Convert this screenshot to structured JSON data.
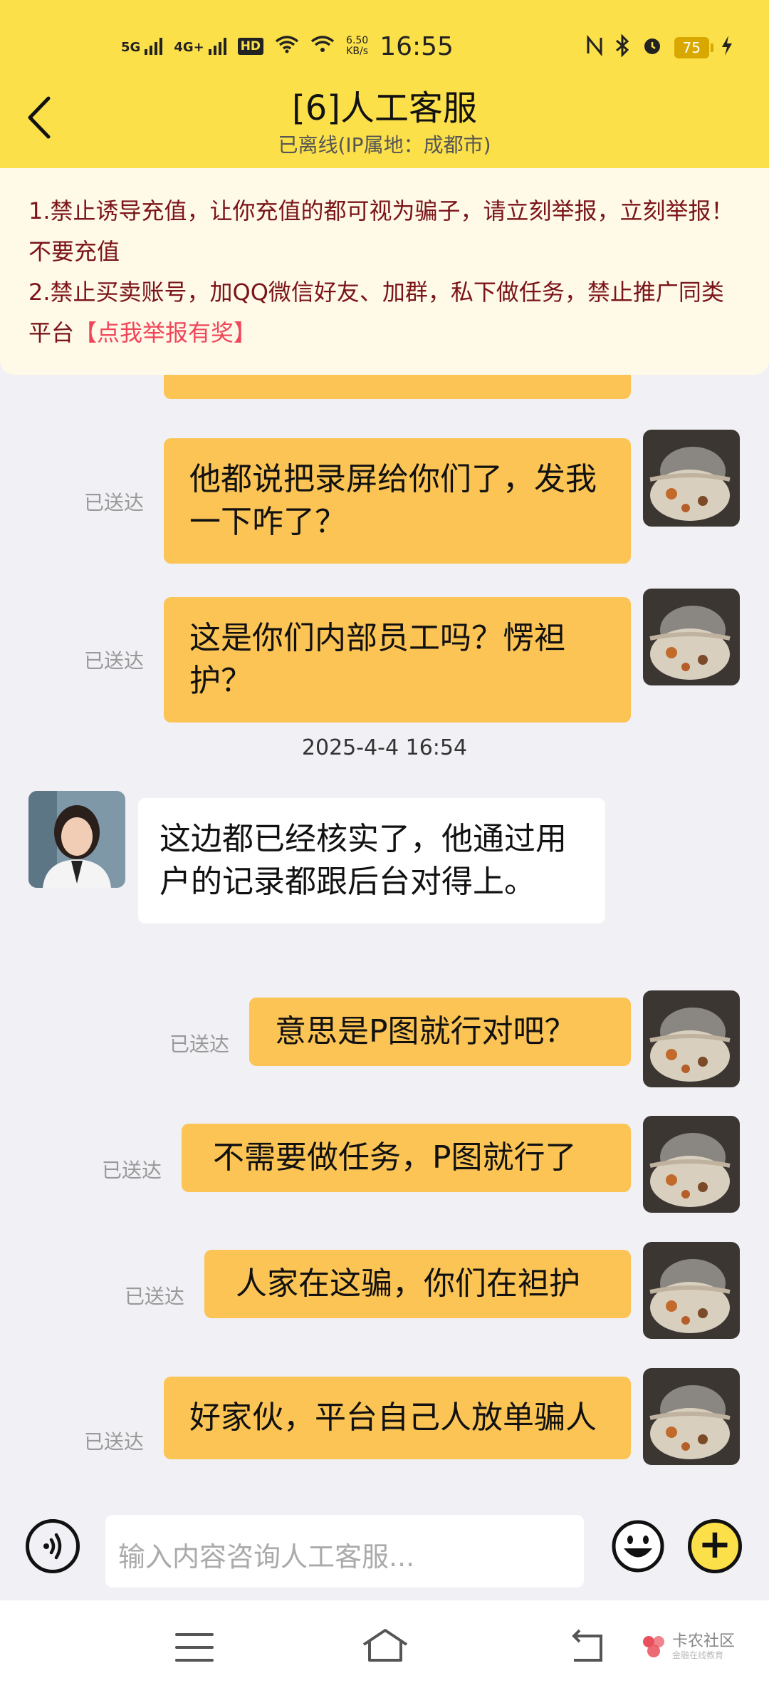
{
  "status_bar": {
    "net1": "5G",
    "net2": "4G+",
    "hd": "HD",
    "speed_value": "6.50",
    "speed_unit": "KB/s",
    "time": "16:55",
    "battery": "75"
  },
  "header": {
    "title": "[6]人工客服",
    "subtitle": "已离线(IP属地：成都市)"
  },
  "notice": {
    "line1": "1.禁止诱导充值，让你充值的都可视为骗子，请立刻举报，立刻举报！不要充值",
    "line2_prefix": "2.禁止买卖账号，加QQ微信好友、加群，私下做任务，禁止推广同类平台",
    "line2_link": "【点我举报有奖】"
  },
  "messages": {
    "m1": {
      "text": "他都说把录屏给你们了，发我一下咋了？",
      "status": "已送达"
    },
    "m2": {
      "text": "这是你们内部员工吗？愣袒护？",
      "status": "已送达"
    },
    "timestamp": "2025-4-4 16:54",
    "agent1": {
      "text": "这边都已经核实了，他通过用户的记录都跟后台对得上。"
    },
    "m3": {
      "text": "意思是P图就行对吧？",
      "status": "已送达"
    },
    "m4": {
      "text": "不需要做任务，P图就行了",
      "status": "已送达"
    },
    "m5": {
      "text": "人家在这骗，你们在袒护",
      "status": "已送达"
    },
    "m6": {
      "text": "好家伙，平台自己人放单骗人",
      "status": "已送达"
    }
  },
  "input": {
    "placeholder": "输入内容咨询人工客服..."
  },
  "watermark": {
    "name": "卡农社区",
    "tagline": "金融在线教育"
  },
  "colors": {
    "header_bg": "#fbe04a",
    "bubble_out": "#fbc455",
    "notice_text": "#7a1418",
    "notice_link": "#f0465a"
  }
}
